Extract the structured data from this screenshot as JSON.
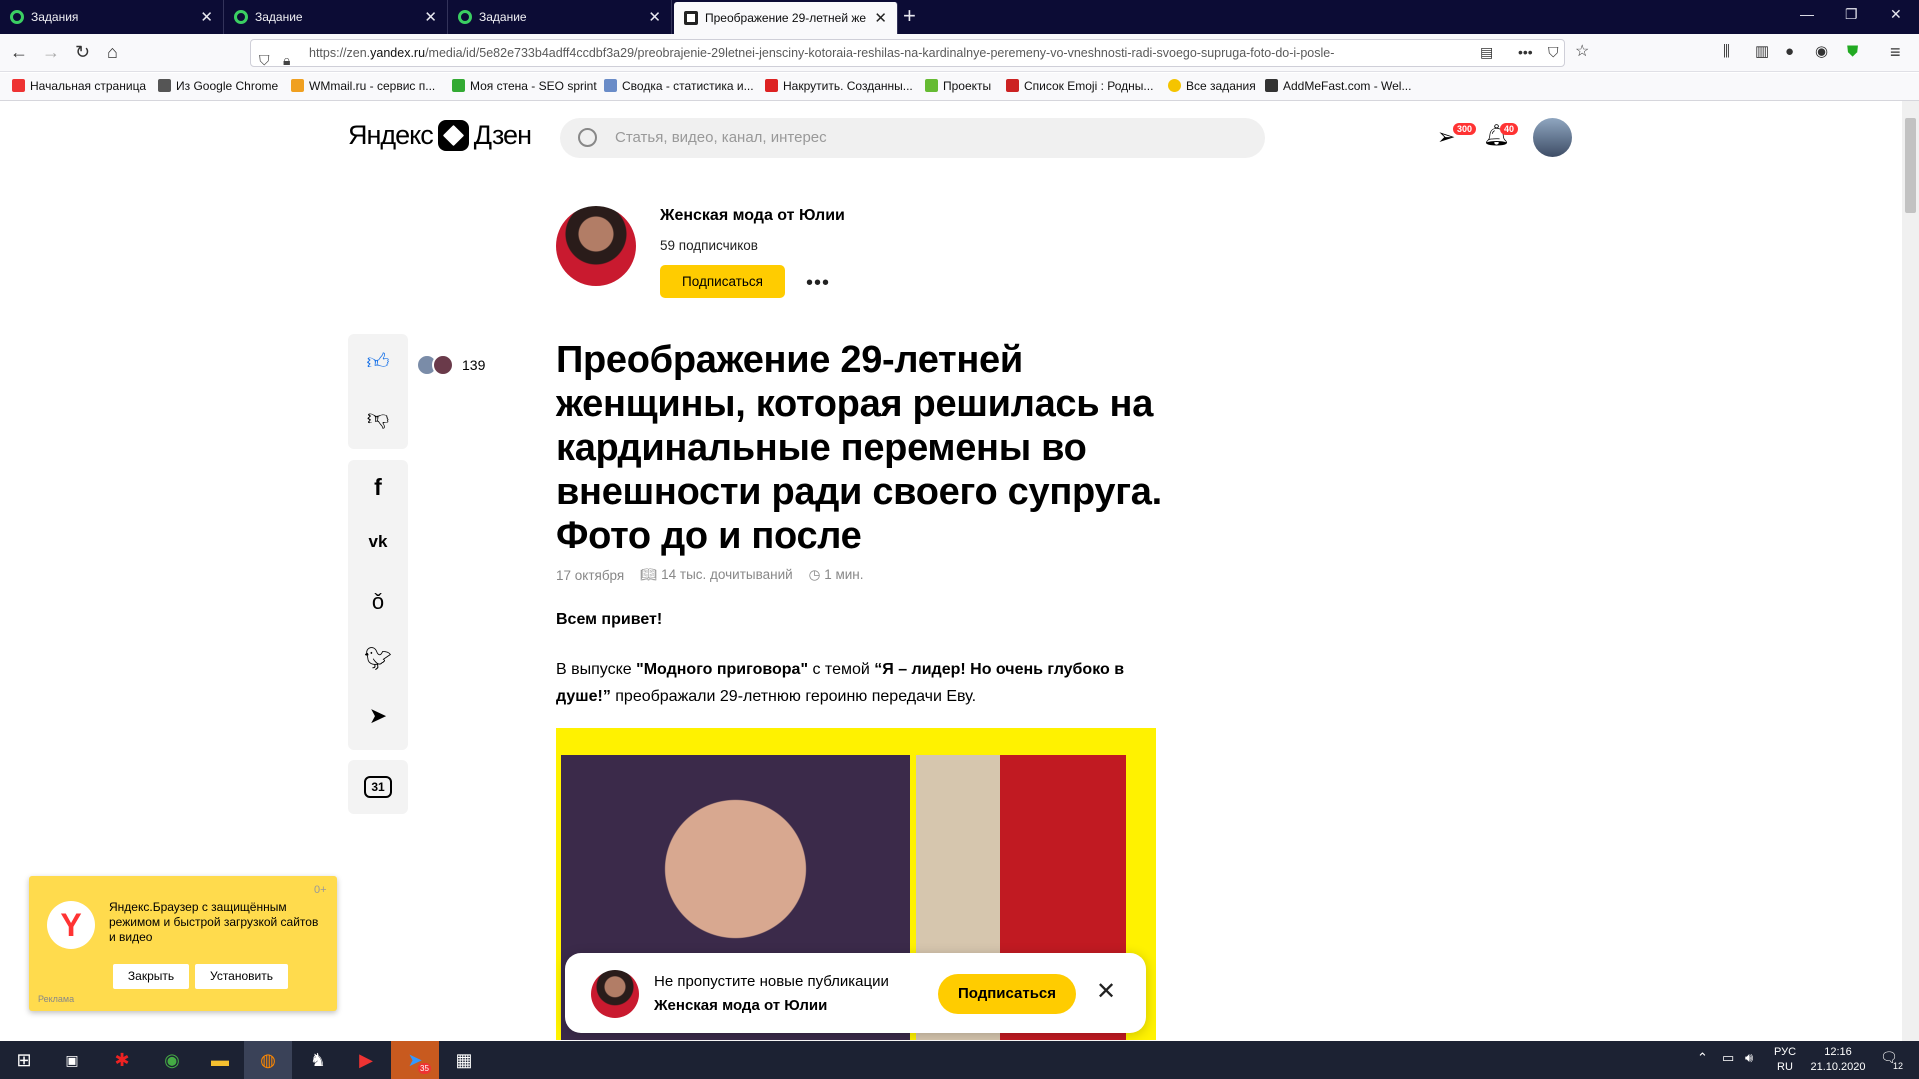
{
  "browser": {
    "tabs": [
      {
        "title": "Задания"
      },
      {
        "title": "Задание"
      },
      {
        "title": "Задание"
      },
      {
        "title": "Преображение 29-летней же"
      }
    ],
    "url_prefix": "https://zen.",
    "url_domain": "yandex.ru",
    "url_rest": "/media/id/5e82e733b4adff4ccdbf3a29/preobrajenie-29letnei-jensciny-kotoraia-reshilas-na-kardinalnye-peremeny-vo-vneshnosti-radi-svoego-supruga-foto-do-i-posle-",
    "bookmarks": [
      {
        "label": "Начальная страница",
        "color": "#e33"
      },
      {
        "label": "Из Google Chrome",
        "color": "#555"
      },
      {
        "label": "WMmail.ru - сервис п...",
        "color": "#f0a020"
      },
      {
        "label": "Моя стена - SEO sprint",
        "color": "#3a3"
      },
      {
        "label": "Сводка - статистика и...",
        "color": "#6a8cc8"
      },
      {
        "label": "Накрутить. Созданны...",
        "color": "#d22"
      },
      {
        "label": "Проекты",
        "color": "#6b3"
      },
      {
        "label": "Список Emoji : Родны...",
        "color": "#c22"
      },
      {
        "label": "Все задания",
        "color": "#f5c400"
      },
      {
        "label": "AddMeFast.com - Wel...",
        "color": "#333"
      }
    ]
  },
  "zen": {
    "logo_left": "Яндекс",
    "logo_right": "Дзен",
    "search_placeholder": "Статья, видео, канал, интерес",
    "messages_badge": "300",
    "notifications_badge": "40"
  },
  "channel": {
    "name": "Женская мода от Юлии",
    "subscribers": "59 подписчиков",
    "subscribe_label": "Подписаться"
  },
  "article": {
    "likes_count": "139",
    "comments_count": "31",
    "title": "Преображение 29-летней женщины, которая решилась на кардинальные перемены во внешности ради своего супруга. Фото до и после",
    "date": "17 октября",
    "reads": "14 тыс. дочитываний",
    "read_time": "1 мин.",
    "greeting": "Всем привет!",
    "p_text1": "В выпуске ",
    "p_bold1": "\"Модного приговора\"",
    "p_text2": " с темой ",
    "p_bold2": "“Я – лидер! Но очень глубоко в душе!”",
    "p_text3": " преображали 29-летнюю героиню передачи Еву."
  },
  "popup": {
    "line1": "Не пропустите новые публикации",
    "line2": "Женская мода от Юлии",
    "button": "Подписаться"
  },
  "ad": {
    "text": "Яндекс.Браузер с защищённым режимом и быстрой загрузкой сайтов и видео",
    "close_label": "Закрыть",
    "install_label": "Установить",
    "age_mark": "0+",
    "ad_label": "Реклама"
  },
  "taskbar": {
    "lang1": "РУС",
    "lang2": "RU",
    "time": "12:16",
    "date": "21.10.2020",
    "telegram_badge": "35",
    "notif_count": "12"
  }
}
